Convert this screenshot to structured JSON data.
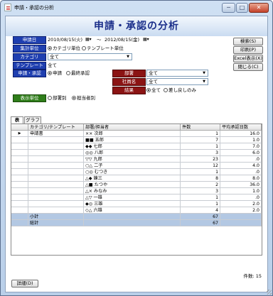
{
  "window": {
    "title": "申請・承認の分析",
    "min": "─",
    "max": "□",
    "close": "✕"
  },
  "header": {
    "title": "申請・承認の分析"
  },
  "filters": {
    "period_label": "申請日",
    "period_from": "2010/08/15(火)",
    "period_sep": "～",
    "period_to": "2012/08/15(金)",
    "agg_label": "集計単位",
    "agg_opt1": "カテゴリ単位",
    "agg_opt2": "テンプレート単位",
    "cat_label": "カテゴリ",
    "cat_value": "全て",
    "tpl_label": "テンプレート",
    "tpl_value": "全て",
    "type_label": "申請・承認",
    "type_opt1": "申請",
    "type_opt2": "最終承認",
    "dept_label": "部署",
    "dept_value": "全て",
    "emp_label": "社員名",
    "emp_value": "全て",
    "result_label": "結果",
    "result_opt1": "全て",
    "result_opt2": "差し戻しのみ",
    "unit_label": "表示単位",
    "unit_opt1": "部署別",
    "unit_opt2": "担当者別"
  },
  "buttons": {
    "search": "検索(S)",
    "print": "印刷(P)",
    "excel": "Excel表示(X)",
    "close": "閉じる(C)",
    "detail": "詳細(D)"
  },
  "tabs": [
    "表",
    "グラフ"
  ],
  "table": {
    "columns": [
      "カテゴリ/テンプレート",
      "部署/担当者",
      "件数",
      "平均承認日数"
    ],
    "rows": [
      {
        "cat": "申請書",
        "person": "××  次郎",
        "count": "1",
        "avg": "16.0",
        "current": true
      },
      {
        "cat": "",
        "person": "■■  五郎",
        "count": "7",
        "avg": "1.0"
      },
      {
        "cat": "",
        "person": "◆◆  七郎",
        "count": "1",
        "avg": "7.0"
      },
      {
        "cat": "",
        "person": "◎◎  八郎",
        "count": "3",
        "avg": "6.0"
      },
      {
        "cat": "",
        "person": "▽▽  九郎",
        "count": "23",
        "avg": ".0"
      },
      {
        "cat": "",
        "person": "○△  二子",
        "count": "12",
        "avg": "4.0"
      },
      {
        "cat": "",
        "person": "○◎  むつき",
        "count": "1",
        "avg": ".0"
      },
      {
        "cat": "",
        "person": "△◆  錬三",
        "count": "8",
        "avg": "8.0"
      },
      {
        "cat": "",
        "person": "△■  たつや",
        "count": "2",
        "avg": "36.0"
      },
      {
        "cat": "",
        "person": "△×  みなみ",
        "count": "3",
        "avg": "1.0"
      },
      {
        "cat": "",
        "person": "△▽  一雄",
        "count": "1",
        "avg": ".0"
      },
      {
        "cat": "",
        "person": "◆◎  三雄",
        "count": "1",
        "avg": "2.0"
      },
      {
        "cat": "",
        "person": "◇△  六雄",
        "count": "4",
        "avg": "2.0"
      }
    ],
    "subtotal": {
      "label": "小計",
      "count": "67"
    },
    "total": {
      "label": "総計",
      "count": "67"
    }
  },
  "footer": {
    "count_text": "件数: 15"
  }
}
